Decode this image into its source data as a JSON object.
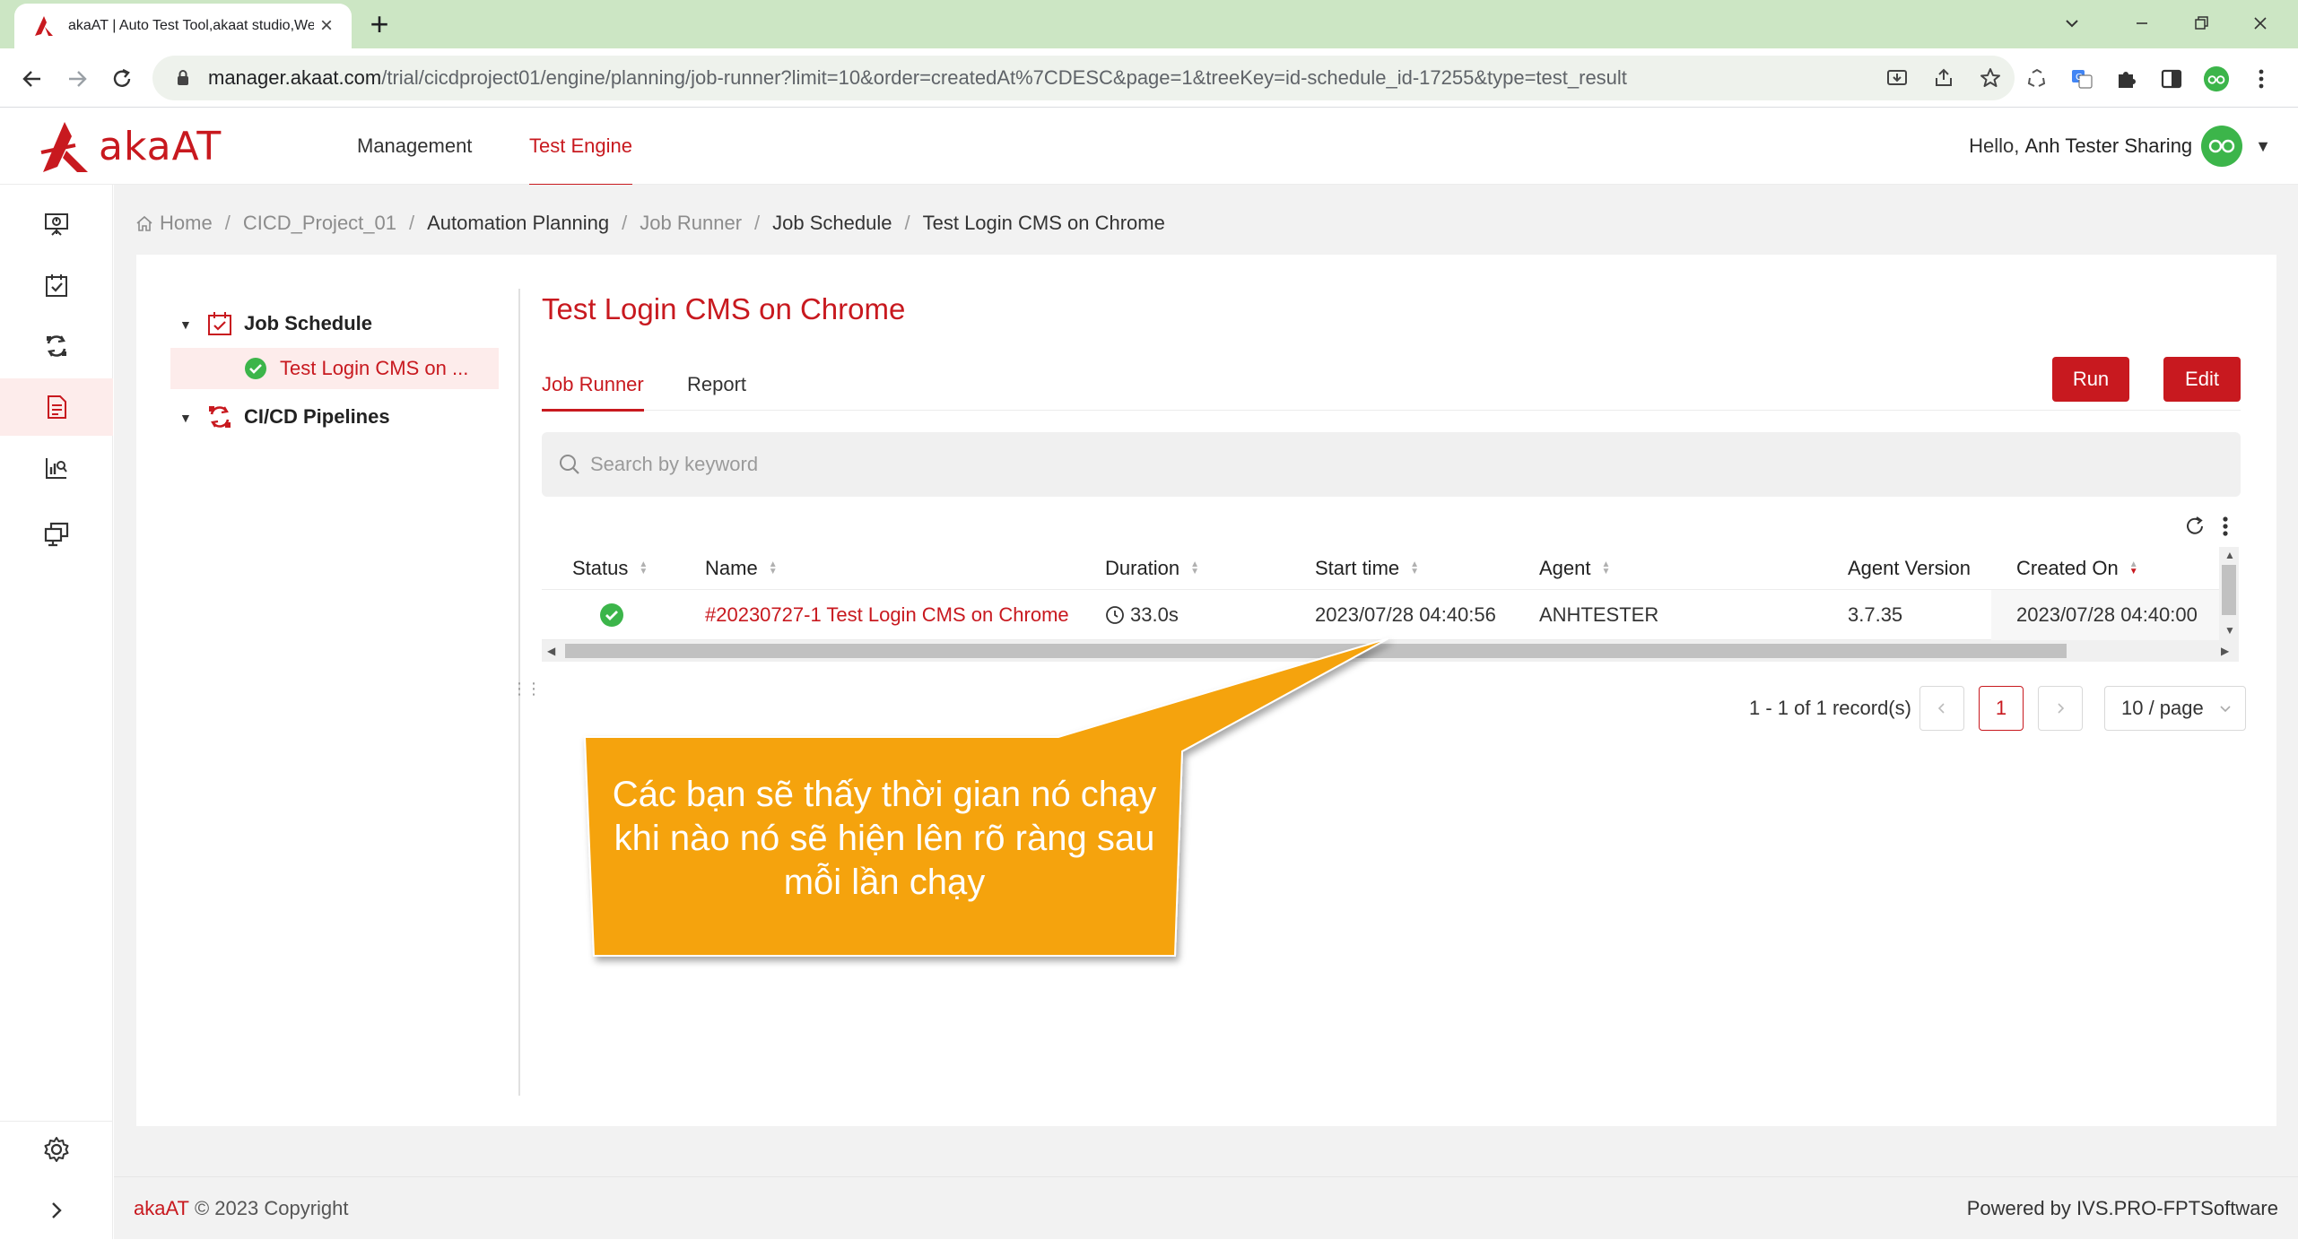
{
  "browser": {
    "tab_title": "akaAT | Auto Test Tool,akaat studio,Web",
    "url_host": "manager.akaat.com",
    "url_path": "/trial/cicdproject01/engine/planning/job-runner?limit=10&order=createdAt%7CDESC&page=1&treeKey=id-schedule_id-17255&type=test_result"
  },
  "header": {
    "logo_text": "akaAT",
    "nav": [
      "Management",
      "Test Engine"
    ],
    "active_nav": "Test Engine",
    "greeting": "Hello,",
    "user_name": "Anh Tester Sharing"
  },
  "breadcrumb": {
    "items": [
      "Home",
      "CICD_Project_01",
      "Automation Planning",
      "Job Runner",
      "Job Schedule",
      "Test Login CMS on Chrome"
    ],
    "separator": "/"
  },
  "tree": {
    "root1": "Job Schedule",
    "child1": "Test Login CMS on ...",
    "root2": "CI/CD Pipelines"
  },
  "page": {
    "title": "Test Login CMS on Chrome",
    "tabs": [
      "Job Runner",
      "Report"
    ],
    "active_tab": "Job Runner",
    "run_label": "Run",
    "edit_label": "Edit",
    "search_placeholder": "Search by keyword"
  },
  "table": {
    "columns": [
      "Status",
      "Name",
      "Duration",
      "Start time",
      "Agent",
      "Agent Version",
      "Created On"
    ],
    "rows": [
      {
        "status": "passed",
        "name": "#20230727-1 Test Login CMS on Chrome",
        "duration": "33.0s",
        "start_time": "2023/07/28 04:40:56",
        "agent": "ANHTESTER",
        "agent_version": "3.7.35",
        "created_on": "2023/07/28 04:40:00"
      }
    ]
  },
  "pagination": {
    "summary": "1 - 1 of 1 record(s)",
    "current_page": "1",
    "page_size": "10 / page"
  },
  "callout": {
    "text": "Các bạn sẽ thấy thời gian nó chạy khi nào nó sẽ hiện lên rõ ràng sau mỗi lần chạy"
  },
  "footer": {
    "brand": "akaAT",
    "copyright": "© 2023 Copyright",
    "powered_prefix": "Powered by",
    "powered_by": "IVS.PRO-FPTSoftware"
  },
  "colors": {
    "accent": "#c8191f",
    "chrome_frame": "#cce6c4",
    "callout": "#f5a30c",
    "success": "#3cb54a"
  }
}
